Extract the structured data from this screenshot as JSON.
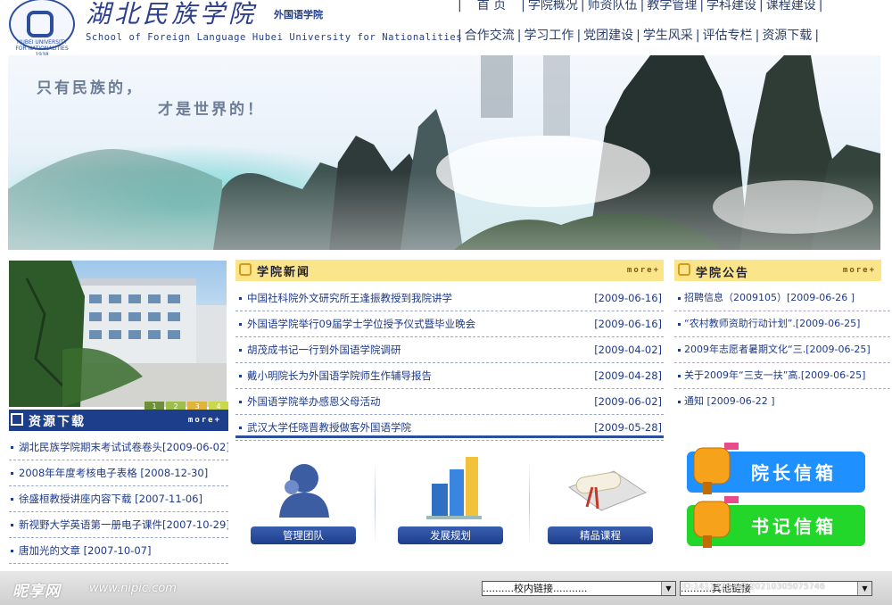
{
  "header": {
    "school_name_cn": "湖北民族学院",
    "school_subtitle": "外国语学院",
    "school_name_en": "School of Foreign Language Hubei University for Nationalities",
    "logo_text": "HUBEI UNIVERSITY FOR NATIONALITIES 1938",
    "nav_row1": [
      "首 页",
      "学院概况",
      "师资队伍",
      "教学管理",
      "学科建设",
      "课程建设"
    ],
    "nav_row2": [
      "合作交流",
      "学习工作",
      "党团建设",
      "学生风采",
      "评估专栏",
      "资源下载"
    ]
  },
  "banner": {
    "slogan_line1": "只有民族的，",
    "slogan_line2": "才是世界的！"
  },
  "photo": {
    "pager": [
      "1",
      "2",
      "3",
      "4"
    ]
  },
  "resources": {
    "title": "资源下载",
    "more": "more+",
    "items": [
      "湖北民族学院期末考试试卷卷头[2009-06-02]",
      "2008年年度考核电子表格 [2008-12-30]",
      "徐盛桓教授讲座内容下载 [2007-11-06]",
      "新视野大学英语第一册电子课件[2007-10-29]",
      "唐加光的文章 [2007-10-07]"
    ]
  },
  "news": {
    "title": "学院新闻",
    "more": "more+",
    "items": [
      {
        "text": "中国社科院外文研究所王逢振教授到我院讲学",
        "date": "[2009-06-16]"
      },
      {
        "text": "外国语学院举行09届学士学位授予仪式暨毕业晚会",
        "date": "[2009-06-16]"
      },
      {
        "text": "胡茂成书记一行到外国语学院调研",
        "date": "[2009-04-02]"
      },
      {
        "text": "戴小明院长为外国语学院师生作辅导报告",
        "date": "[2009-04-28]"
      },
      {
        "text": "外国语学院举办感恩父母活动",
        "date": "[2009-06-02]"
      },
      {
        "text": "武汉大学任晓晋教授做客外国语学院",
        "date": "[2009-05-28]"
      }
    ]
  },
  "features": [
    "管理团队",
    "发展规划",
    "精品课程"
  ],
  "notices": {
    "title": "学院公告",
    "more": "more+",
    "items": [
      "招聘信息（2009105）[2009-06-26 ]",
      "“农村教师资助行动计划”.[2009-06-25]",
      "2009年志愿者暑期文化“三.[2009-06-25]",
      "关于2009年“三支一扶”高.[2009-06-25]",
      "通知 [2009-06-22 ]"
    ]
  },
  "mailboxes": {
    "president": "院长信箱",
    "secretary": "书记信箱"
  },
  "footer": {
    "watermark": "昵享网",
    "watermark_url": "www.nipic.com",
    "campus_links_select": "..........校内链接...........",
    "other_links_select": "..........其他链接",
    "watermark_id": "ID:1411328 NO:20210305075746"
  },
  "colors": {
    "nav_blue": "#1d3e8a",
    "section_yellow": "#fbe58a",
    "mailbox_blue": "#1e90ff",
    "mailbox_green": "#22d62a"
  }
}
